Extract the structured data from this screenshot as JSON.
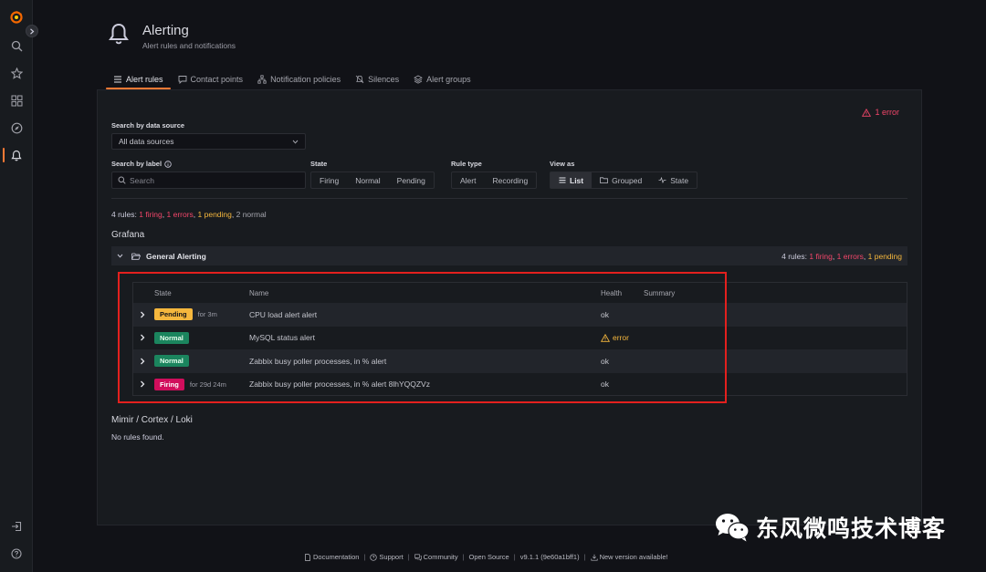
{
  "nav": {
    "items": [
      {
        "name": "grafana-logo-icon"
      },
      {
        "name": "search-icon"
      },
      {
        "name": "starred-icon"
      },
      {
        "name": "dashboards-icon"
      },
      {
        "name": "explore-icon"
      },
      {
        "name": "alerting-icon"
      }
    ],
    "bottom": [
      {
        "name": "sign-in-icon"
      },
      {
        "name": "help-icon"
      }
    ],
    "accent": "#ff7a35"
  },
  "header": {
    "title": "Alerting",
    "subtitle": "Alert rules and notifications"
  },
  "tabs": [
    {
      "label": "Alert rules",
      "icon": "list-icon",
      "active": true
    },
    {
      "label": "Contact points",
      "icon": "comment-alt-share-icon"
    },
    {
      "label": "Notification policies",
      "icon": "sitemap-icon"
    },
    {
      "label": "Silences",
      "icon": "bell-slash-icon"
    },
    {
      "label": "Alert groups",
      "icon": "layer-group-icon"
    }
  ],
  "errors_badge": "1 error",
  "filters": {
    "datasource_label": "Search by data source",
    "datasource_value": "All data sources",
    "label_label": "Search by label",
    "label_placeholder": "Search",
    "state_label": "State",
    "state_options": [
      "Firing",
      "Normal",
      "Pending"
    ],
    "ruletype_label": "Rule type",
    "ruletype_options": [
      "Alert",
      "Recording"
    ],
    "view_label": "View as",
    "view_options": [
      "List",
      "Grouped",
      "State"
    ],
    "view_selected": "List"
  },
  "summary": {
    "prefix": "4 rules: ",
    "firing": "1 firing",
    "sep1": ", ",
    "errors": "1 errors",
    "sep2": ", ",
    "pending": "1 pending",
    "sep3": ", ",
    "normal": "2 normal"
  },
  "grafana_section": {
    "title": "Grafana",
    "group": {
      "name": "General Alerting",
      "stats_prefix": "4 rules: ",
      "firing": "1 firing",
      "sep1": ", ",
      "errors": "1 errors",
      "sep2": ", ",
      "pending": "1 pending"
    },
    "table": {
      "headers": {
        "state": "State",
        "name": "Name",
        "health": "Health",
        "summary": "Summary"
      },
      "rows": [
        {
          "state": "Pending",
          "duration": "for 3m",
          "name": "CPU load alert alert",
          "health": "ok"
        },
        {
          "state": "Normal",
          "duration": "",
          "name": "MySQL status alert",
          "health": "error"
        },
        {
          "state": "Normal",
          "duration": "",
          "name": "Zabbix busy poller processes, in % alert",
          "health": "ok"
        },
        {
          "state": "Firing",
          "duration": "for 29d 24m",
          "name": "Zabbix busy poller processes, in % alert 8lhYQQZVz",
          "health": "ok"
        }
      ]
    }
  },
  "mimir_section": {
    "title": "Mimir / Cortex / Loki",
    "empty": "No rules found."
  },
  "footer": {
    "documentation": "Documentation",
    "support": "Support",
    "community": "Community",
    "open_source": "Open Source",
    "version": "v9.1.1 (9e60a1bff1)",
    "new_version": "New version available!",
    "sep": "|"
  },
  "watermark": {
    "text": "东风微鸣技术博客"
  },
  "colors": {
    "firing": "#d10e5c",
    "pending": "#f5b73d",
    "normal": "#1b855e",
    "error": "#f3466a",
    "highlight_box": "#e3201e"
  }
}
